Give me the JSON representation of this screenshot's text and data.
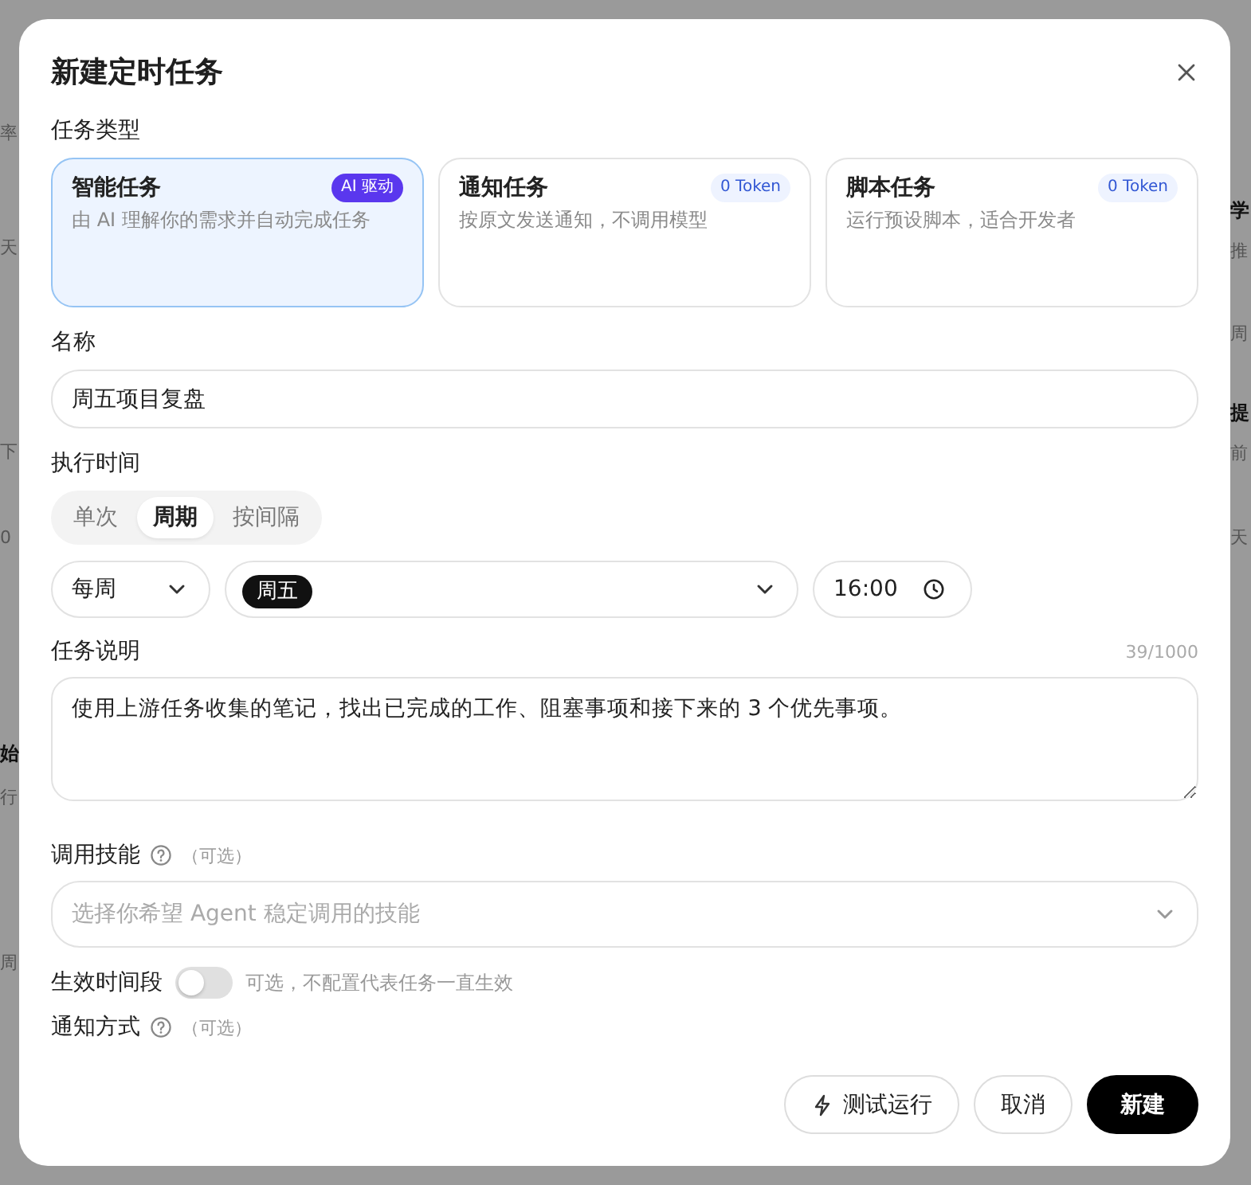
{
  "backdrop": {
    "left_fragments": [
      {
        "text": "率",
        "bold": false
      },
      {
        "text": "天",
        "bold": false
      },
      {
        "text": "下",
        "bold": false
      },
      {
        "text": "0",
        "bold": false
      },
      {
        "text": "始",
        "bold": true
      },
      {
        "text": "行",
        "bold": false
      },
      {
        "text": "周",
        "bold": false
      }
    ],
    "right_fragments": [
      {
        "text": "学",
        "bold": true
      },
      {
        "text": "推",
        "bold": false
      },
      {
        "text": "周",
        "bold": false
      },
      {
        "text": "提",
        "bold": true
      },
      {
        "text": "前",
        "bold": false
      },
      {
        "text": "天",
        "bold": false
      }
    ]
  },
  "dialog": {
    "title": "新建定时任务",
    "task_type": {
      "label": "任务类型",
      "options": [
        {
          "title": "智能任务",
          "description": "由 AI 理解你的需求并自动完成任务",
          "badge": "AI 驱动",
          "kind": "ai",
          "selected": true
        },
        {
          "title": "通知任务",
          "description": "按原文发送通知，不调用模型",
          "badge": "0 Token",
          "kind": "token",
          "selected": false
        },
        {
          "title": "脚本任务",
          "description": "运行预设脚本，适合开发者",
          "badge": "0 Token",
          "kind": "token",
          "selected": false
        }
      ]
    },
    "name": {
      "label": "名称",
      "value": "周五项目复盘"
    },
    "schedule": {
      "label": "执行时间",
      "modes": [
        {
          "label": "单次",
          "selected": false
        },
        {
          "label": "周期",
          "selected": true
        },
        {
          "label": "按间隔",
          "selected": false
        }
      ],
      "frequency": "每周",
      "days": [
        "周五"
      ],
      "time": "16:00"
    },
    "description": {
      "label": "任务说明",
      "counter": "39/1000",
      "value": "使用上游任务收集的笔记，找出已完成的工作、阻塞事项和接下来的 3 个优先事项。"
    },
    "skills": {
      "label": "调用技能",
      "optional": "（可选）",
      "placeholder": "选择你希望 Agent 稳定调用的技能"
    },
    "active_period": {
      "label": "生效时间段",
      "on": false,
      "hint": "可选，不配置代表任务一直生效"
    },
    "notify": {
      "label": "通知方式",
      "optional": "（可选）"
    },
    "buttons": [
      {
        "label": "测试运行",
        "kind": "outline_icon"
      },
      {
        "label": "取消",
        "kind": "outline"
      },
      {
        "label": "新建",
        "kind": "primary"
      }
    ]
  }
}
